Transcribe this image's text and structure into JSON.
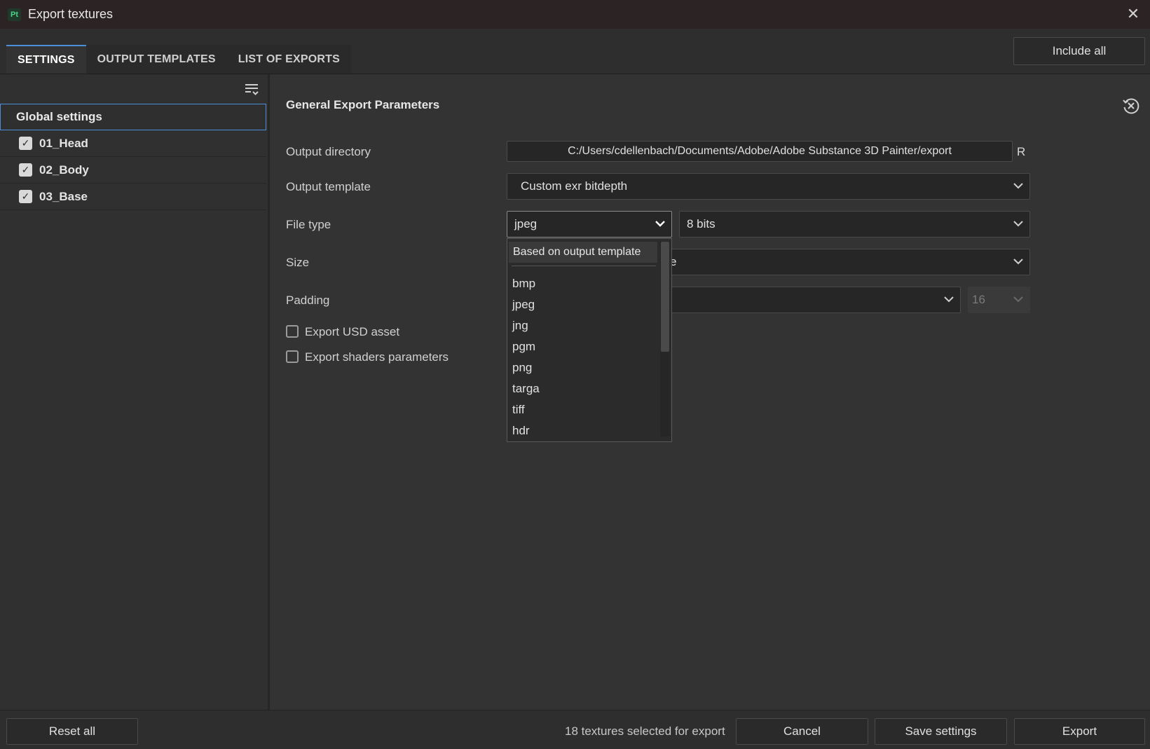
{
  "window": {
    "app_badge": "Pt",
    "title": "Export textures"
  },
  "tabs": [
    {
      "label": "SETTINGS",
      "active": true
    },
    {
      "label": "OUTPUT TEMPLATES",
      "active": false
    },
    {
      "label": "LIST OF EXPORTS",
      "active": false
    }
  ],
  "header": {
    "include_all_label": "Include all"
  },
  "sidebar": {
    "global_label": "Global settings",
    "meshes": [
      {
        "label": "01_Head",
        "checked": true
      },
      {
        "label": "02_Body",
        "checked": true
      },
      {
        "label": "03_Base",
        "checked": true
      }
    ]
  },
  "main": {
    "section_title": "General Export Parameters",
    "output_directory": {
      "label": "Output directory",
      "value": "C:/Users/cdellenbach/Documents/Adobe/Adobe Substance 3D Painter/export",
      "suffix": "R"
    },
    "output_template": {
      "label": "Output template",
      "value": "Custom exr bitdepth"
    },
    "file_type": {
      "label": "File type",
      "value": "jpeg",
      "bit_depth": "8 bits"
    },
    "size": {
      "label": "Size",
      "value_visible": "e"
    },
    "padding": {
      "label": "Padding",
      "dilation_value": "16"
    },
    "export_usd": {
      "label": "Export USD asset",
      "checked": false
    },
    "export_shaders": {
      "label": "Export shaders parameters",
      "checked": false
    }
  },
  "file_type_dropdown": {
    "first": "Based on output template",
    "options": [
      "bmp",
      "jpeg",
      "jng",
      "pgm",
      "png",
      "targa",
      "tiff",
      "hdr"
    ]
  },
  "footer": {
    "reset_label": "Reset all",
    "status": "18 textures selected for export",
    "cancel_label": "Cancel",
    "save_label": "Save settings",
    "export_label": "Export"
  },
  "colors": {
    "accent": "#4a8fd8",
    "background": "#333333",
    "titlebar": "#2c2424"
  }
}
